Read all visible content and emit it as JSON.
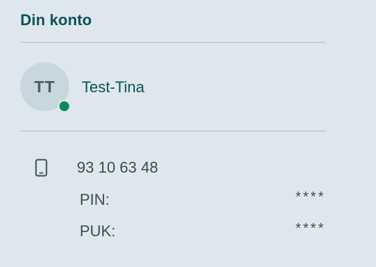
{
  "account": {
    "title": "Din konto"
  },
  "user": {
    "initials": "TT",
    "name": "Test-Tina",
    "status": "online",
    "status_color": "#0a8a59"
  },
  "subscription": {
    "phone_icon": "mobile-phone-icon",
    "phone_number": "93 10 63 48",
    "pin_label": "PIN:",
    "pin_value": "****",
    "puk_label": "PUK:",
    "puk_value": "****"
  },
  "colors": {
    "background": "#dfe7ee",
    "title": "#0b5258",
    "text": "#3e4b52",
    "avatar_bg": "#c7d7dd"
  }
}
